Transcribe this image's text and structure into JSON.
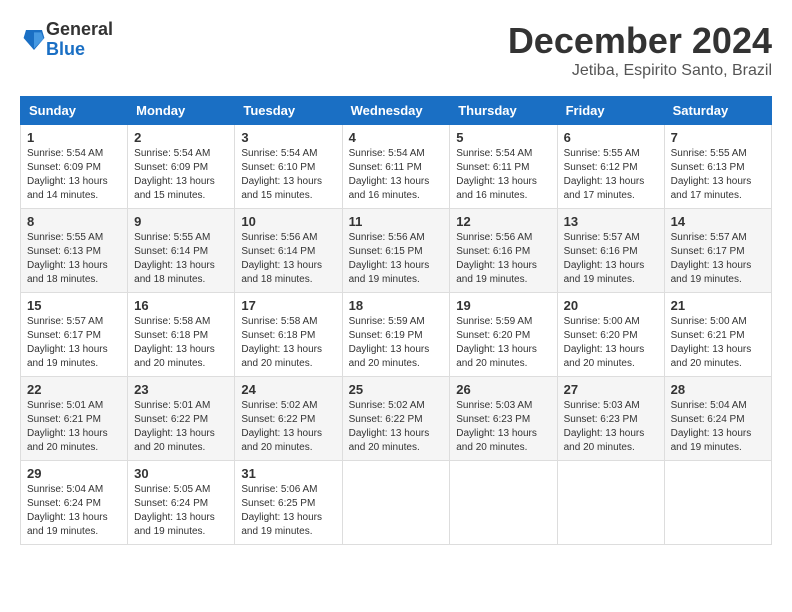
{
  "logo": {
    "general": "General",
    "blue": "Blue"
  },
  "header": {
    "month": "December 2024",
    "location": "Jetiba, Espirito Santo, Brazil"
  },
  "weekdays": [
    "Sunday",
    "Monday",
    "Tuesday",
    "Wednesday",
    "Thursday",
    "Friday",
    "Saturday"
  ],
  "weeks": [
    [
      {
        "day": "1",
        "sunrise": "5:54 AM",
        "sunset": "6:09 PM",
        "daylight": "13 hours and 14 minutes."
      },
      {
        "day": "2",
        "sunrise": "5:54 AM",
        "sunset": "6:09 PM",
        "daylight": "13 hours and 15 minutes."
      },
      {
        "day": "3",
        "sunrise": "5:54 AM",
        "sunset": "6:10 PM",
        "daylight": "13 hours and 15 minutes."
      },
      {
        "day": "4",
        "sunrise": "5:54 AM",
        "sunset": "6:11 PM",
        "daylight": "13 hours and 16 minutes."
      },
      {
        "day": "5",
        "sunrise": "5:54 AM",
        "sunset": "6:11 PM",
        "daylight": "13 hours and 16 minutes."
      },
      {
        "day": "6",
        "sunrise": "5:55 AM",
        "sunset": "6:12 PM",
        "daylight": "13 hours and 17 minutes."
      },
      {
        "day": "7",
        "sunrise": "5:55 AM",
        "sunset": "6:13 PM",
        "daylight": "13 hours and 17 minutes."
      }
    ],
    [
      {
        "day": "8",
        "sunrise": "5:55 AM",
        "sunset": "6:13 PM",
        "daylight": "13 hours and 18 minutes."
      },
      {
        "day": "9",
        "sunrise": "5:55 AM",
        "sunset": "6:14 PM",
        "daylight": "13 hours and 18 minutes."
      },
      {
        "day": "10",
        "sunrise": "5:56 AM",
        "sunset": "6:14 PM",
        "daylight": "13 hours and 18 minutes."
      },
      {
        "day": "11",
        "sunrise": "5:56 AM",
        "sunset": "6:15 PM",
        "daylight": "13 hours and 19 minutes."
      },
      {
        "day": "12",
        "sunrise": "5:56 AM",
        "sunset": "6:16 PM",
        "daylight": "13 hours and 19 minutes."
      },
      {
        "day": "13",
        "sunrise": "5:57 AM",
        "sunset": "6:16 PM",
        "daylight": "13 hours and 19 minutes."
      },
      {
        "day": "14",
        "sunrise": "5:57 AM",
        "sunset": "6:17 PM",
        "daylight": "13 hours and 19 minutes."
      }
    ],
    [
      {
        "day": "15",
        "sunrise": "5:57 AM",
        "sunset": "6:17 PM",
        "daylight": "13 hours and 19 minutes."
      },
      {
        "day": "16",
        "sunrise": "5:58 AM",
        "sunset": "6:18 PM",
        "daylight": "13 hours and 20 minutes."
      },
      {
        "day": "17",
        "sunrise": "5:58 AM",
        "sunset": "6:18 PM",
        "daylight": "13 hours and 20 minutes."
      },
      {
        "day": "18",
        "sunrise": "5:59 AM",
        "sunset": "6:19 PM",
        "daylight": "13 hours and 20 minutes."
      },
      {
        "day": "19",
        "sunrise": "5:59 AM",
        "sunset": "6:20 PM",
        "daylight": "13 hours and 20 minutes."
      },
      {
        "day": "20",
        "sunrise": "5:00 AM",
        "sunset": "6:20 PM",
        "daylight": "13 hours and 20 minutes."
      },
      {
        "day": "21",
        "sunrise": "5:00 AM",
        "sunset": "6:21 PM",
        "daylight": "13 hours and 20 minutes."
      }
    ],
    [
      {
        "day": "22",
        "sunrise": "5:01 AM",
        "sunset": "6:21 PM",
        "daylight": "13 hours and 20 minutes."
      },
      {
        "day": "23",
        "sunrise": "5:01 AM",
        "sunset": "6:22 PM",
        "daylight": "13 hours and 20 minutes."
      },
      {
        "day": "24",
        "sunrise": "5:02 AM",
        "sunset": "6:22 PM",
        "daylight": "13 hours and 20 minutes."
      },
      {
        "day": "25",
        "sunrise": "5:02 AM",
        "sunset": "6:22 PM",
        "daylight": "13 hours and 20 minutes."
      },
      {
        "day": "26",
        "sunrise": "5:03 AM",
        "sunset": "6:23 PM",
        "daylight": "13 hours and 20 minutes."
      },
      {
        "day": "27",
        "sunrise": "5:03 AM",
        "sunset": "6:23 PM",
        "daylight": "13 hours and 20 minutes."
      },
      {
        "day": "28",
        "sunrise": "5:04 AM",
        "sunset": "6:24 PM",
        "daylight": "13 hours and 19 minutes."
      }
    ],
    [
      {
        "day": "29",
        "sunrise": "5:04 AM",
        "sunset": "6:24 PM",
        "daylight": "13 hours and 19 minutes."
      },
      {
        "day": "30",
        "sunrise": "5:05 AM",
        "sunset": "6:24 PM",
        "daylight": "13 hours and 19 minutes."
      },
      {
        "day": "31",
        "sunrise": "5:06 AM",
        "sunset": "6:25 PM",
        "daylight": "13 hours and 19 minutes."
      },
      null,
      null,
      null,
      null
    ]
  ]
}
